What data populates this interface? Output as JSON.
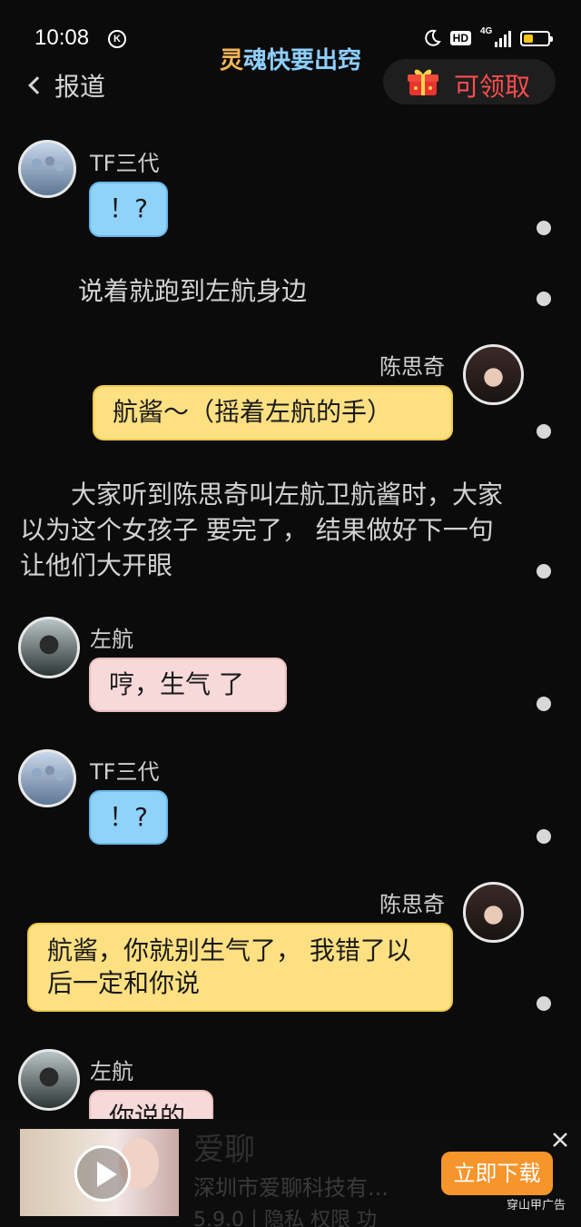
{
  "status": {
    "time": "10:08",
    "k_badge": "K",
    "hd": "HD",
    "network": "4G"
  },
  "header": {
    "title_first": "灵",
    "title_rest": "魂快要出窍",
    "back_label": "报道",
    "reward_label": "可领取"
  },
  "colors": {
    "blue_bubble": "#8fd3fb",
    "pink_bubble": "#f8d9d9",
    "yellow_bubble": "#fde082",
    "reward_red": "#ff4d4f",
    "download_orange": "#f6952b"
  },
  "chat": {
    "m1": {
      "name": "TF三代",
      "text": "！?"
    },
    "n1": "说着就跑到左航身边",
    "m2": {
      "name": "陈思奇",
      "text": "航酱～（摇着左航的手）"
    },
    "n2": "　　大家听到陈思奇叫左航卫航酱时，大家以为这个女孩子 要完了， 结果做好下一句让他们大开眼",
    "m3": {
      "name": "左航",
      "text": "哼，生气 了"
    },
    "m4": {
      "name": "TF三代",
      "text": "！?"
    },
    "m5": {
      "name": "陈思奇",
      "text": "航酱，你就别生气了， 我错了以后一定和你说"
    },
    "m6": {
      "name": "左航",
      "text": "你说的"
    }
  },
  "ad": {
    "title": "爱聊",
    "subtitle": "深圳市爱聊科技有...",
    "meta": "5.9.0丨隐私  权限  功",
    "download_label": "立即下载",
    "source": "穿山甲广告"
  }
}
